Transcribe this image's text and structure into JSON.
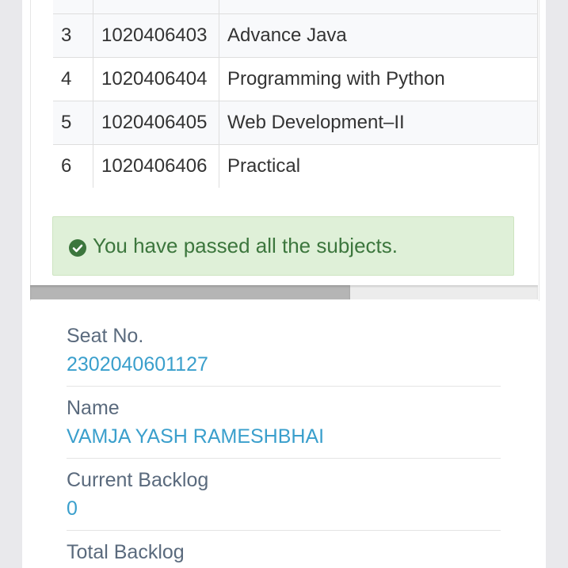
{
  "subjects": {
    "rows": [
      {
        "no": "3",
        "code": "1020406403",
        "name": "Advance Java"
      },
      {
        "no": "4",
        "code": "1020406404",
        "name": "Programming with Python"
      },
      {
        "no": "5",
        "code": "1020406405",
        "name": "Web Development–II"
      },
      {
        "no": "6",
        "code": "1020406406",
        "name": "Practical"
      }
    ]
  },
  "alert": {
    "icon": "check-circle-icon",
    "message": "You have passed all the subjects.",
    "color": "#3c763d",
    "background": "#dff0d8"
  },
  "scroll": {
    "position_fraction": 0.63
  },
  "student": {
    "seat_label": "Seat No.",
    "seat_value": "2302040601127",
    "name_label": "Name",
    "name_value": "VAMJA YASH RAMESHBHAI",
    "current_backlog_label": "Current Backlog",
    "current_backlog_value": "0",
    "total_backlog_label": "Total Backlog"
  },
  "colors": {
    "value_text": "#3a9fcc",
    "label_text": "#5a6a7d"
  }
}
